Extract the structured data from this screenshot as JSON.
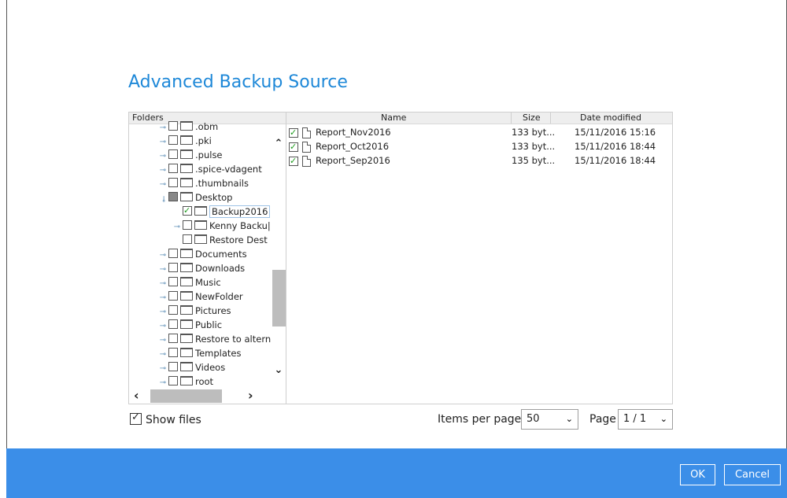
{
  "dialog": {
    "title": "Advanced Backup Source"
  },
  "tree": {
    "header": "Folders",
    "items": [
      {
        "label": ".obm",
        "state": "unchecked",
        "expander": "collapsed"
      },
      {
        "label": ".pki",
        "state": "unchecked",
        "expander": "collapsed"
      },
      {
        "label": ".pulse",
        "state": "unchecked",
        "expander": "collapsed"
      },
      {
        "label": ".spice-vdagent",
        "state": "unchecked",
        "expander": "collapsed"
      },
      {
        "label": ".thumbnails",
        "state": "unchecked",
        "expander": "collapsed"
      },
      {
        "label": "Desktop",
        "state": "partial",
        "expander": "expanded"
      },
      {
        "label": "Backup2016",
        "state": "checked",
        "expander": "none"
      },
      {
        "label": "Kenny Backu|",
        "state": "unchecked",
        "expander": "collapsed"
      },
      {
        "label": "Restore Dest",
        "state": "unchecked",
        "expander": "none"
      },
      {
        "label": "Documents",
        "state": "unchecked",
        "expander": "collapsed"
      },
      {
        "label": "Downloads",
        "state": "unchecked",
        "expander": "collapsed"
      },
      {
        "label": "Music",
        "state": "unchecked",
        "expander": "collapsed"
      },
      {
        "label": "NewFolder",
        "state": "unchecked",
        "expander": "collapsed"
      },
      {
        "label": "Pictures",
        "state": "unchecked",
        "expander": "collapsed"
      },
      {
        "label": "Public",
        "state": "unchecked",
        "expander": "collapsed"
      },
      {
        "label": "Restore to altern",
        "state": "unchecked",
        "expander": "collapsed"
      },
      {
        "label": "Templates",
        "state": "unchecked",
        "expander": "collapsed"
      },
      {
        "label": "Videos",
        "state": "unchecked",
        "expander": "collapsed"
      },
      {
        "label": "root",
        "state": "unchecked",
        "expander": "collapsed"
      }
    ]
  },
  "files": {
    "columns": {
      "name": "Name",
      "size": "Size",
      "date": "Date modified"
    },
    "rows": [
      {
        "name": "Report_Nov2016",
        "size": "133 byt...",
        "date": "15/11/2016 15:16",
        "checked": true
      },
      {
        "name": "Report_Oct2016",
        "size": "133 byt...",
        "date": "15/11/2016 18:44",
        "checked": true
      },
      {
        "name": "Report_Sep2016",
        "size": "135 byt...",
        "date": "15/11/2016 18:44",
        "checked": true
      }
    ]
  },
  "controls": {
    "show_files_label": "Show files",
    "show_files_checked": true,
    "items_per_page_label": "Items per page",
    "items_per_page_value": "50",
    "page_label": "Page",
    "page_value": "1 / 1"
  },
  "footer": {
    "ok_label": "OK",
    "cancel_label": "Cancel"
  },
  "colors": {
    "title_bar": "#424242",
    "heading": "#1e88d8",
    "footer_bar": "#3b8ee8",
    "check": "#1c9a1c"
  },
  "icons": [
    "folder-icon",
    "file-icon",
    "checkbox-icon",
    "chevron-up-icon",
    "chevron-down-icon",
    "chevron-left-icon",
    "chevron-right-icon"
  ]
}
